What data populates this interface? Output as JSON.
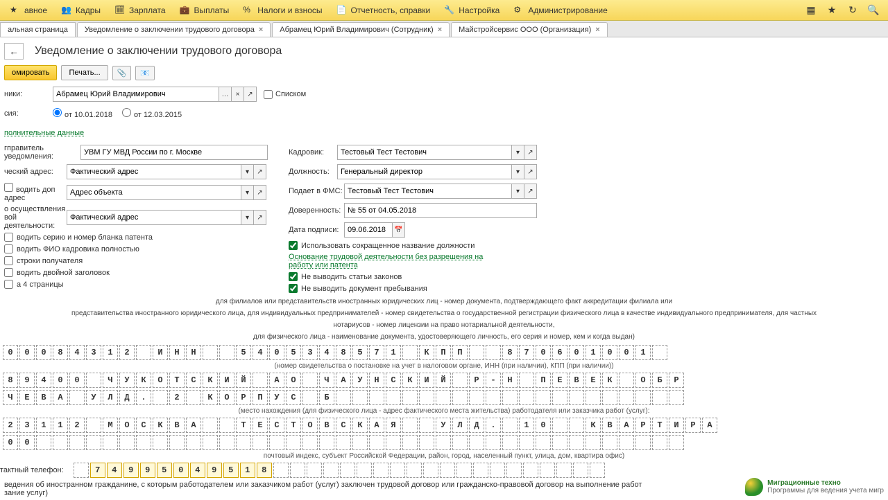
{
  "topbar": {
    "items": [
      "авное",
      "Кадры",
      "Зарплата",
      "Выплаты",
      "Налоги и взносы",
      "Отчетность, справки",
      "Настройка",
      "Администрирование"
    ]
  },
  "tabs": [
    {
      "label": "альная страница",
      "closable": false
    },
    {
      "label": "Уведомление о заключении трудового договора",
      "closable": true
    },
    {
      "label": "Абрамец Юрий Владимирович (Сотрудник)",
      "closable": true
    },
    {
      "label": "Майстройсервис ООО (Организация)",
      "closable": true
    }
  ],
  "page_title": "Уведомление о заключении трудового договора",
  "toolbar": {
    "form": "омировать",
    "print": "Печать..."
  },
  "fields": {
    "employees_label": "ники:",
    "employee_value": "Абрамец Юрий Владимирович",
    "list_label": "Списком",
    "version_label": "сия:",
    "radio1": "от 10.01.2018",
    "radio2": "от 12.03.2015",
    "additional_data": "полнительные данные",
    "sender_label": "гправитель уведомления:",
    "sender_value": "УВМ ГУ МВД России по г. Москве",
    "addr_label": "ческий адрес:",
    "addr_value": "Фактический адрес",
    "addl_addr_label": "водить доп адрес",
    "addl_addr_value": "Адрес объекта",
    "activity_label": "о осуществления\nвой деятельности:",
    "activity_value": "Фактический адрес",
    "hr_label": "Кадровик:",
    "hr_value": "Тестовый Тест Тестович",
    "pos_label": "Должность:",
    "pos_value": "Генеральный директор",
    "fms_label": "Подает в ФМС:",
    "fms_value": "Тестовый Тест Тестович",
    "poa_label": "Доверенность:",
    "poa_value": "№ 55 от 04.05.2018",
    "sign_date_label": "Дата подписи:",
    "sign_date_value": "09.06.2018",
    "cb1": "водить серию и номер бланка патента",
    "cb2": "водить ФИО кадровика полностью",
    "cb3": "строки получателя",
    "cb4": "водить двойной заголовок",
    "cb5": "а 4 страницы",
    "gcb1": "Использовать сокращенное название должности",
    "green_link": "Основание трудовой деятельности без разрешения на работу или патента",
    "gcb2": "Не выводить статьи законов",
    "gcb3": "Не выводить документ пребывания"
  },
  "doc": {
    "line1": "для филиалов или представительств иностранных юридических лиц - номер документа, подтверждающего факт аккредитации филиала или",
    "line2": "представительства иностранного юридического лица, для индивидуальных предпринимателей - номер свидетельства о государственной регистрации физического лица в качестве индивидуального предпринимателя, для частных",
    "line3": "нотариусов - номер лицензии на право нотариальной деятельности,",
    "line4": "для физического лица - наименование документа, удостоверяющего личность, его серия и номер, кем и когда выдан)",
    "cap1": "(номер свидетельства о постановке на учет в налоговом органе, ИНН (при наличии), КПП (при наличии))",
    "cap2": "(место нахождения (для физического лица - адрес фактического места жительства) работодателя или заказчика работ (услуг):",
    "cap3": "почтовый индекс, субъект Российской Федерации, район, город, населенный пункт, улица, дом, квартира офис)",
    "phone_label": "тактный телефон:",
    "footer": "ведения об иностранном гражданине, с которым работодателем или заказчиком работ (услуг) заключен трудовой договор или гражданско-правовой договор на выполнение работ\nзание услуг)"
  },
  "rows": {
    "r1": [
      "0",
      "0",
      "0",
      "8",
      "4",
      "3",
      "1",
      "2",
      "",
      "И",
      "Н",
      "Н",
      "",
      "",
      "5",
      "4",
      "0",
      "5",
      "3",
      "4",
      "8",
      "5",
      "7",
      "1",
      "",
      "К",
      "П",
      "П",
      "",
      "",
      "8",
      "7",
      "0",
      "6",
      "0",
      "1",
      "0",
      "0",
      "1",
      ""
    ],
    "r2": [
      "8",
      "9",
      "4",
      "0",
      "0",
      "",
      "Ч",
      "У",
      "К",
      "О",
      "Т",
      "С",
      "К",
      "И",
      "Й",
      "",
      "А",
      "О",
      "",
      "Ч",
      "А",
      "У",
      "Н",
      "С",
      "К",
      "И",
      "Й",
      "",
      "Р",
      "-",
      "Н",
      "",
      "П",
      "Е",
      "В",
      "Е",
      "К",
      "",
      "О",
      "Б",
      "Р"
    ],
    "r3": [
      "Ч",
      "Е",
      "В",
      "А",
      "",
      "У",
      "Л",
      "Д",
      ".",
      "",
      "2",
      "",
      "К",
      "О",
      "Р",
      "П",
      "У",
      "С",
      "",
      "Б",
      "",
      "",
      "",
      "",
      "",
      "",
      "",
      "",
      "",
      "",
      "",
      "",
      "",
      "",
      "",
      "",
      "",
      "",
      "",
      "",
      ""
    ],
    "r4": [
      "2",
      "3",
      "1",
      "1",
      "2",
      "",
      "М",
      "О",
      "С",
      "К",
      "В",
      "А",
      "",
      "",
      "Т",
      "Е",
      "С",
      "Т",
      "О",
      "В",
      "С",
      "К",
      "А",
      "Я",
      "",
      "",
      "У",
      "Л",
      "Д",
      ".",
      "",
      "1",
      "0",
      "",
      "",
      "К",
      "В",
      "А",
      "Р",
      "Т",
      "И",
      "Р",
      "А"
    ],
    "r5": [
      "0",
      "0",
      "",
      "",
      "",
      "",
      "",
      "",
      "",
      "",
      "",
      "",
      "",
      "",
      "",
      "",
      "",
      "",
      "",
      "",
      "",
      "",
      "",
      "",
      "",
      "",
      "",
      "",
      "",
      "",
      "",
      "",
      "",
      "",
      "",
      "",
      "",
      "",
      "",
      "",
      ""
    ],
    "phone": [
      "",
      "7",
      "4",
      "9",
      "9",
      "5",
      "0",
      "4",
      "9",
      "5",
      "1",
      "8",
      "",
      "",
      "",
      "",
      "",
      "",
      "",
      "",
      "",
      "",
      "",
      "",
      "",
      "",
      "",
      "",
      "",
      "",
      "",
      ""
    ]
  },
  "footer_brand": {
    "t1": "Миграционные техно",
    "t2": "Программы для ведения учета мигр"
  }
}
